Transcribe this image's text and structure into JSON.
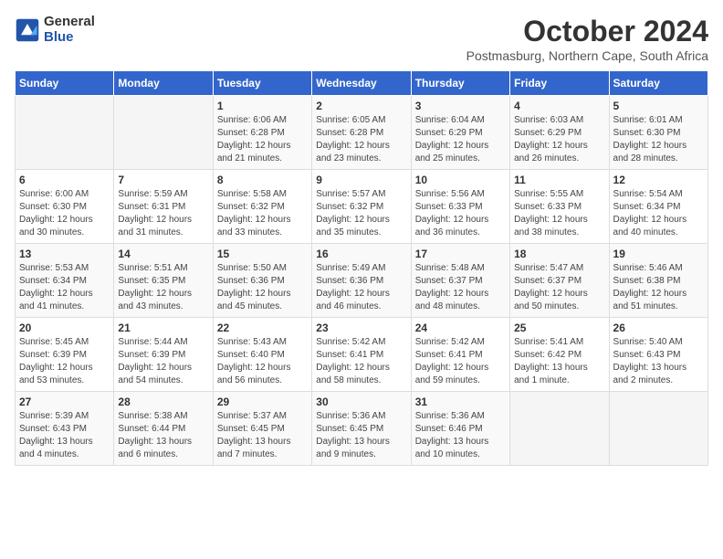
{
  "logo": {
    "general": "General",
    "blue": "Blue"
  },
  "header": {
    "month": "October 2024",
    "location": "Postmasburg, Northern Cape, South Africa"
  },
  "weekdays": [
    "Sunday",
    "Monday",
    "Tuesday",
    "Wednesday",
    "Thursday",
    "Friday",
    "Saturday"
  ],
  "weeks": [
    [
      {
        "day": "",
        "info": ""
      },
      {
        "day": "",
        "info": ""
      },
      {
        "day": "1",
        "info": "Sunrise: 6:06 AM\nSunset: 6:28 PM\nDaylight: 12 hours and 21 minutes."
      },
      {
        "day": "2",
        "info": "Sunrise: 6:05 AM\nSunset: 6:28 PM\nDaylight: 12 hours and 23 minutes."
      },
      {
        "day": "3",
        "info": "Sunrise: 6:04 AM\nSunset: 6:29 PM\nDaylight: 12 hours and 25 minutes."
      },
      {
        "day": "4",
        "info": "Sunrise: 6:03 AM\nSunset: 6:29 PM\nDaylight: 12 hours and 26 minutes."
      },
      {
        "day": "5",
        "info": "Sunrise: 6:01 AM\nSunset: 6:30 PM\nDaylight: 12 hours and 28 minutes."
      }
    ],
    [
      {
        "day": "6",
        "info": "Sunrise: 6:00 AM\nSunset: 6:30 PM\nDaylight: 12 hours and 30 minutes."
      },
      {
        "day": "7",
        "info": "Sunrise: 5:59 AM\nSunset: 6:31 PM\nDaylight: 12 hours and 31 minutes."
      },
      {
        "day": "8",
        "info": "Sunrise: 5:58 AM\nSunset: 6:32 PM\nDaylight: 12 hours and 33 minutes."
      },
      {
        "day": "9",
        "info": "Sunrise: 5:57 AM\nSunset: 6:32 PM\nDaylight: 12 hours and 35 minutes."
      },
      {
        "day": "10",
        "info": "Sunrise: 5:56 AM\nSunset: 6:33 PM\nDaylight: 12 hours and 36 minutes."
      },
      {
        "day": "11",
        "info": "Sunrise: 5:55 AM\nSunset: 6:33 PM\nDaylight: 12 hours and 38 minutes."
      },
      {
        "day": "12",
        "info": "Sunrise: 5:54 AM\nSunset: 6:34 PM\nDaylight: 12 hours and 40 minutes."
      }
    ],
    [
      {
        "day": "13",
        "info": "Sunrise: 5:53 AM\nSunset: 6:34 PM\nDaylight: 12 hours and 41 minutes."
      },
      {
        "day": "14",
        "info": "Sunrise: 5:51 AM\nSunset: 6:35 PM\nDaylight: 12 hours and 43 minutes."
      },
      {
        "day": "15",
        "info": "Sunrise: 5:50 AM\nSunset: 6:36 PM\nDaylight: 12 hours and 45 minutes."
      },
      {
        "day": "16",
        "info": "Sunrise: 5:49 AM\nSunset: 6:36 PM\nDaylight: 12 hours and 46 minutes."
      },
      {
        "day": "17",
        "info": "Sunrise: 5:48 AM\nSunset: 6:37 PM\nDaylight: 12 hours and 48 minutes."
      },
      {
        "day": "18",
        "info": "Sunrise: 5:47 AM\nSunset: 6:37 PM\nDaylight: 12 hours and 50 minutes."
      },
      {
        "day": "19",
        "info": "Sunrise: 5:46 AM\nSunset: 6:38 PM\nDaylight: 12 hours and 51 minutes."
      }
    ],
    [
      {
        "day": "20",
        "info": "Sunrise: 5:45 AM\nSunset: 6:39 PM\nDaylight: 12 hours and 53 minutes."
      },
      {
        "day": "21",
        "info": "Sunrise: 5:44 AM\nSunset: 6:39 PM\nDaylight: 12 hours and 54 minutes."
      },
      {
        "day": "22",
        "info": "Sunrise: 5:43 AM\nSunset: 6:40 PM\nDaylight: 12 hours and 56 minutes."
      },
      {
        "day": "23",
        "info": "Sunrise: 5:42 AM\nSunset: 6:41 PM\nDaylight: 12 hours and 58 minutes."
      },
      {
        "day": "24",
        "info": "Sunrise: 5:42 AM\nSunset: 6:41 PM\nDaylight: 12 hours and 59 minutes."
      },
      {
        "day": "25",
        "info": "Sunrise: 5:41 AM\nSunset: 6:42 PM\nDaylight: 13 hours and 1 minute."
      },
      {
        "day": "26",
        "info": "Sunrise: 5:40 AM\nSunset: 6:43 PM\nDaylight: 13 hours and 2 minutes."
      }
    ],
    [
      {
        "day": "27",
        "info": "Sunrise: 5:39 AM\nSunset: 6:43 PM\nDaylight: 13 hours and 4 minutes."
      },
      {
        "day": "28",
        "info": "Sunrise: 5:38 AM\nSunset: 6:44 PM\nDaylight: 13 hours and 6 minutes."
      },
      {
        "day": "29",
        "info": "Sunrise: 5:37 AM\nSunset: 6:45 PM\nDaylight: 13 hours and 7 minutes."
      },
      {
        "day": "30",
        "info": "Sunrise: 5:36 AM\nSunset: 6:45 PM\nDaylight: 13 hours and 9 minutes."
      },
      {
        "day": "31",
        "info": "Sunrise: 5:36 AM\nSunset: 6:46 PM\nDaylight: 13 hours and 10 minutes."
      },
      {
        "day": "",
        "info": ""
      },
      {
        "day": "",
        "info": ""
      }
    ]
  ]
}
